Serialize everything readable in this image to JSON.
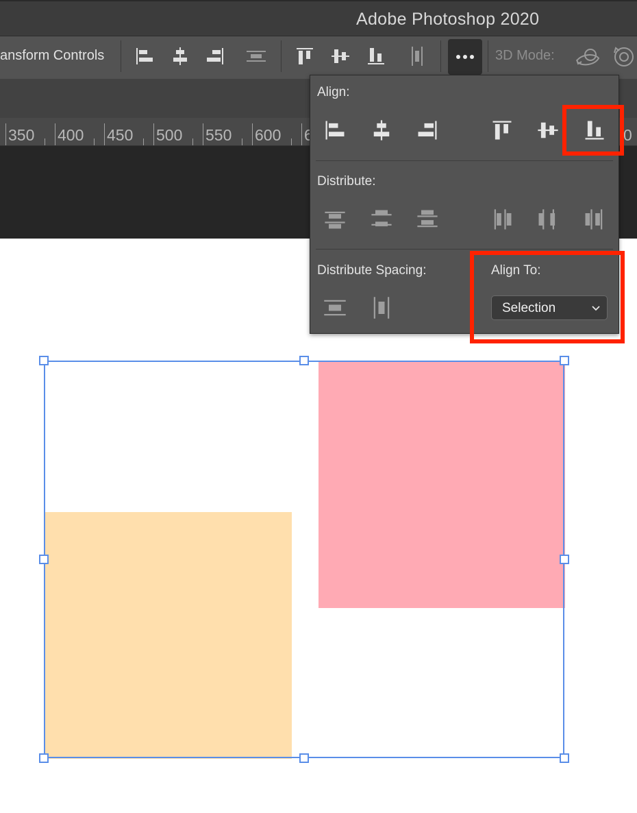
{
  "app": {
    "title": "Adobe Photoshop 2020"
  },
  "options_bar": {
    "transform_label": "ansform Controls",
    "mode3d_label": "3D Mode:",
    "more_button": "more-options",
    "icons": [
      "align-left-edges-icon",
      "align-horizontal-centers-icon",
      "align-right-edges-icon",
      "distribute-horizontal-spacing-icon",
      "align-top-edges-icon",
      "align-vertical-centers-icon",
      "align-bottom-edges-icon",
      "distribute-vertical-spacing-icon",
      "more-icon",
      "orbit-3d-icon",
      "rotate-3d-icon"
    ]
  },
  "ruler": {
    "labels": [
      "350",
      "400",
      "450",
      "500",
      "550",
      "600",
      "6",
      "0"
    ]
  },
  "align_popup": {
    "align_label": "Align:",
    "distribute_label": "Distribute:",
    "distribute_spacing_label": "Distribute Spacing:",
    "align_to_label": "Align To:",
    "align_to_value": "Selection",
    "highlighted_button": "align-bottom-edges"
  },
  "canvas": {
    "shapes": [
      {
        "name": "orange-square",
        "color": "#ffdfad"
      },
      {
        "name": "pink-square",
        "color": "#ffaab4"
      }
    ],
    "selection_color": "#5a8ee8",
    "highlight_color": "#ff2200"
  }
}
